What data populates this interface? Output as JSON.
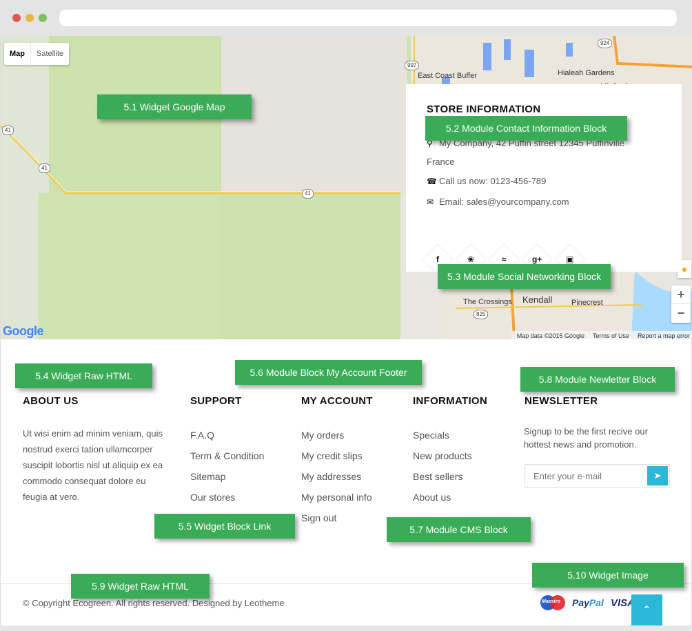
{
  "map": {
    "type_buttons": [
      "Map",
      "Satellite"
    ],
    "google": "Google",
    "footer": [
      "Map data ©2015 Google",
      "Terms of Use",
      "Report a map error"
    ],
    "place_labels": [
      "East Coast Buffer",
      "Hialeah Gardens",
      "Hialeah",
      "The Crossings",
      "Kendall",
      "Pinecrest"
    ],
    "route_shields": [
      "924",
      "997",
      "41",
      "41",
      "41",
      "825"
    ],
    "zoom_in": "+",
    "zoom_out": "−"
  },
  "store": {
    "title": "STORE INFORMATION",
    "address": "My Company, 42 Puffin street 12345 Puffinville",
    "country": "France",
    "phone_label": "Call us now:",
    "phone": "0123-456-789",
    "email_label": "Email:",
    "email": "sales@yourcompany.com",
    "social": [
      "f",
      "t",
      "rss",
      "g+",
      "ig"
    ]
  },
  "tags": {
    "t51": "5.1 Widget Google Map",
    "t52": "5.2 Module Contact Information Block",
    "t53": "5.3 Module Social Networking Block",
    "t54": "5.4 Widget Raw HTML",
    "t55": "5.5 Widget Block Link",
    "t56": "5.6 Module Block My Account Footer",
    "t57": "5.7 Module CMS Block",
    "t58": "5.8 Module Newletter Block",
    "t59": "5.9 Widget Raw HTML",
    "t510": "5.10 Widget Image"
  },
  "footer": {
    "about": {
      "title": "ABOUT US",
      "text": "Ut wisi enim ad minim veniam, quis nostrud exerci tation ullamcorper suscipit lobortis nisl ut aliquip ex ea commodo consequat dolore eu feugia at vero."
    },
    "support": {
      "title": "SUPPORT",
      "links": [
        "F.A.Q",
        "Term & Condition",
        "Sitemap",
        "Our stores"
      ]
    },
    "account": {
      "title": "MY ACCOUNT",
      "links": [
        "My orders",
        "My credit slips",
        "My addresses",
        "My personal info",
        "Sign out"
      ]
    },
    "information": {
      "title": "INFORMATION",
      "links": [
        "Specials",
        "New products",
        "Best sellers",
        "About us"
      ]
    },
    "newsletter": {
      "title": "NEWSLETTER",
      "text": "Signup to be the first recive our hottest news and promotion.",
      "placeholder": "Enter your e-mail"
    },
    "copyright": "© Copyright Ecogreen. All rights reserved. Designed by Leotheme",
    "payments": {
      "maestro": "Maestro",
      "paypal_a": "Pay",
      "paypal_b": "Pal",
      "visa": "VISA"
    }
  },
  "colors": {
    "accent_green": "#3aab56",
    "accent_blue": "#2bb7d8"
  }
}
